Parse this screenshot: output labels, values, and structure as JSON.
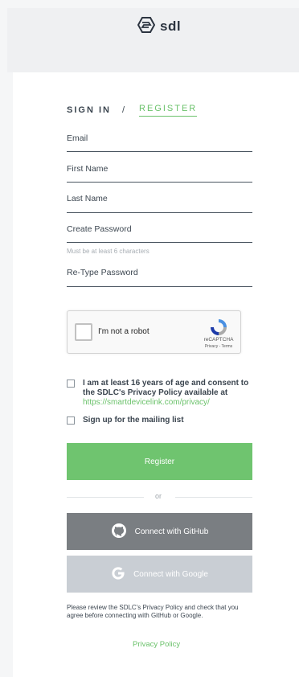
{
  "header": {
    "brand": "sdl"
  },
  "tabs": {
    "signin": "SIGN IN",
    "separator": "/",
    "register": "REGISTER"
  },
  "form": {
    "email_label": "Email",
    "first_name_label": "First Name",
    "last_name_label": "Last Name",
    "password_label": "Create Password",
    "password_hint": "Must be at least 6 characters",
    "retype_label": "Re-Type Password"
  },
  "recaptcha": {
    "label": "I'm not a robot",
    "brand": "reCAPTCHA",
    "terms": "Privacy - Terms"
  },
  "consent": {
    "age_text": "I am at least 16 years of age and consent to the SDLC's Privacy Policy available at",
    "age_link": "https://smartdevicelink.com/privacy/",
    "mailing_text": "Sign up for the mailing list"
  },
  "buttons": {
    "register": "Register",
    "or": "or",
    "github": "Connect with GitHub",
    "google": "Connect with Google"
  },
  "footer": {
    "note": "Please review the SDLC's Privacy Policy and check that you agree before connecting with GitHub or Google.",
    "privacy_link": "Privacy Policy"
  },
  "colors": {
    "accent": "#6bc26b",
    "github_bg": "#7a7e82",
    "google_bg": "#c9ced4"
  },
  "icons": {
    "logo": "sdl-logo-icon",
    "github": "github-icon",
    "google": "google-icon",
    "recaptcha": "recaptcha-icon"
  }
}
